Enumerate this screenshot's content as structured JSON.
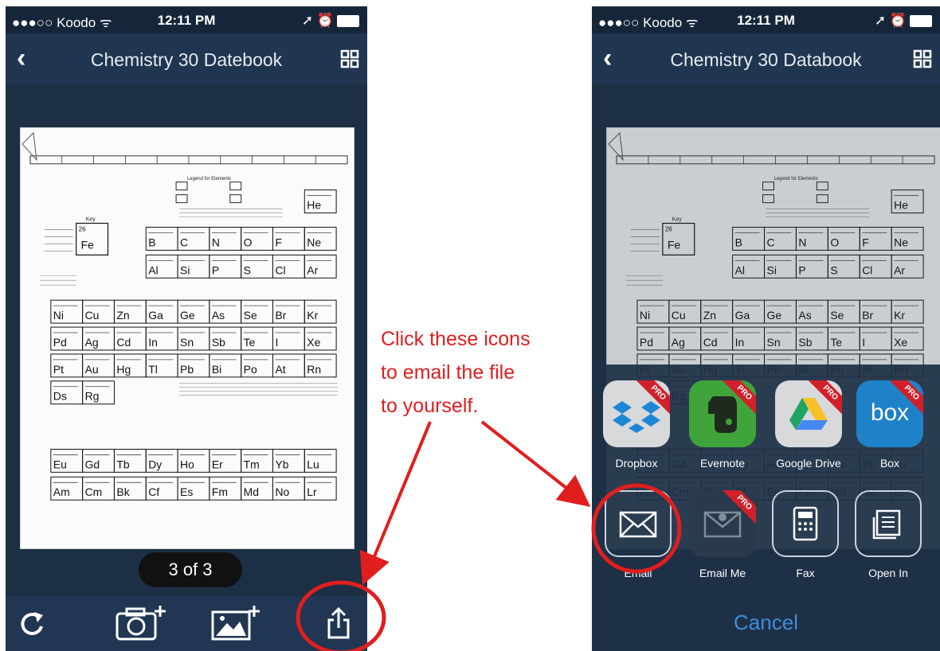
{
  "left": {
    "status": {
      "carrier": "●●●○○ Koodo ᯤ",
      "time": "12:11 PM",
      "indicators": "➚ ⏰"
    },
    "nav": {
      "title": "Chemistry 30 Datebook"
    },
    "page_indicator": "3 of 3",
    "icons": [
      "back-chevron-icon",
      "grid-icon",
      "refresh-icon",
      "add-photo-camera-icon",
      "add-image-icon",
      "share-icon"
    ]
  },
  "right": {
    "status": {
      "carrier": "●●●○○ Koodo ᯤ",
      "time": "12:11 PM",
      "indicators": "➚ ⏰"
    },
    "nav": {
      "title": "Chemistry 30 Databook"
    },
    "apps": [
      {
        "label": "Dropbox",
        "badge": "PRO",
        "color": "#d9d9d9"
      },
      {
        "label": "Evernote",
        "badge": "PRO",
        "color": "#3fa43a"
      },
      {
        "label": "Google Drive",
        "badge": "PRO",
        "color": "#d9d9d9"
      },
      {
        "label": "Box",
        "badge": "PRO",
        "color": "#1f82c8",
        "logo_text": "box"
      }
    ],
    "actions": [
      {
        "label": "Email",
        "badge": ""
      },
      {
        "label": "Email Me",
        "badge": "PRO"
      },
      {
        "label": "Fax",
        "badge": ""
      },
      {
        "label": "Open In",
        "badge": ""
      }
    ],
    "cancel": "Cancel"
  },
  "annotation": {
    "lines": [
      "Click these icons",
      "to email the file",
      "to yourself."
    ],
    "color": "#e01e1e"
  },
  "periodic_table": {
    "rows": [
      [
        "He"
      ],
      [
        "B",
        "C",
        "N",
        "O",
        "F",
        "Ne"
      ],
      [
        "Al",
        "Si",
        "P",
        "S",
        "Cl",
        "Ar"
      ],
      [
        "Ni",
        "Cu",
        "Zn",
        "Ga",
        "Ge",
        "As",
        "Se",
        "Br",
        "Kr"
      ],
      [
        "Pd",
        "Ag",
        "Cd",
        "In",
        "Sn",
        "Sb",
        "Te",
        "I",
        "Xe"
      ],
      [
        "Pt",
        "Au",
        "Hg",
        "Tl",
        "Pb",
        "Bi",
        "Po",
        "At",
        "Rn"
      ],
      [
        "Ds",
        "Rg"
      ]
    ],
    "lanthanides": [
      "Eu",
      "Gd",
      "Tb",
      "Dy",
      "Ho",
      "Er",
      "Tm",
      "Yb",
      "Lu"
    ],
    "actinides": [
      "Am",
      "Cm",
      "Bk",
      "Cf",
      "Es",
      "Fm",
      "Md",
      "No",
      "Lr"
    ],
    "key_symbol": "Fe",
    "key_number": "26",
    "key_title": "Key",
    "legend_title": "Legend for Elements"
  }
}
